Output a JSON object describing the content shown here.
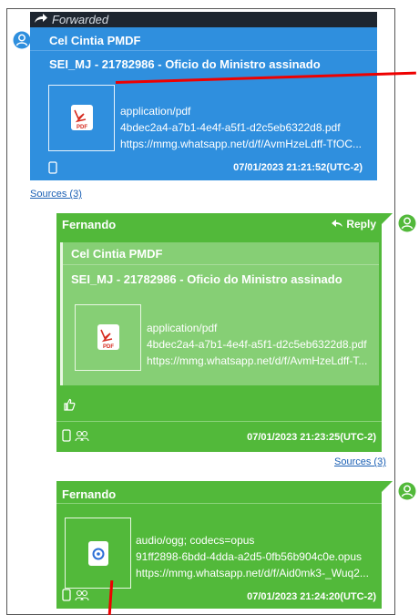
{
  "messages": [
    {
      "forwarded_label": "Forwarded",
      "sender": "Cel Cintia PMDF",
      "subject": "SEI_MJ - 21782986 - Oficio do Ministro assinado",
      "attachment": {
        "mime": "application/pdf",
        "filename": "4bdec2a4-a7b1-4e4f-a5f1-d2c5eb6322d8.pdf",
        "url": "https://mmg.whatsapp.net/d/f/AvmHzeLdff-TfOC...",
        "icon": "pdf-icon"
      },
      "timestamp": "07/01/2023 21:21:52(UTC-2)",
      "sources": "Sources (3)",
      "color": "#2f8fde"
    },
    {
      "sender": "Fernando",
      "reply_label": "Reply",
      "quoted": {
        "sender": "Cel Cintia PMDF",
        "subject": "SEI_MJ - 21782986 - Oficio do Ministro assinado",
        "attachment": {
          "mime": "application/pdf",
          "filename": "4bdec2a4-a7b1-4e4f-a5f1-d2c5eb6322d8.pdf",
          "url": "https://mmg.whatsapp.net/d/f/AvmHzeLdff-T..."
        }
      },
      "reaction": "thumbs-up-icon",
      "timestamp": "07/01/2023 21:23:25(UTC-2)",
      "sources": "Sources (3)",
      "color": "#52b93a"
    },
    {
      "sender": "Fernando",
      "attachment": {
        "mime": "audio/ogg; codecs=opus",
        "filename": "91ff2898-6bdd-4dda-a2d5-0fb56b904c0e.opus",
        "url": "https://mmg.whatsapp.net/d/f/Aid0mk3-_Wuq2...",
        "icon": "audio-file-icon"
      },
      "timestamp": "07/01/2023 21:24:20(UTC-2)",
      "color": "#52b93a"
    }
  ]
}
